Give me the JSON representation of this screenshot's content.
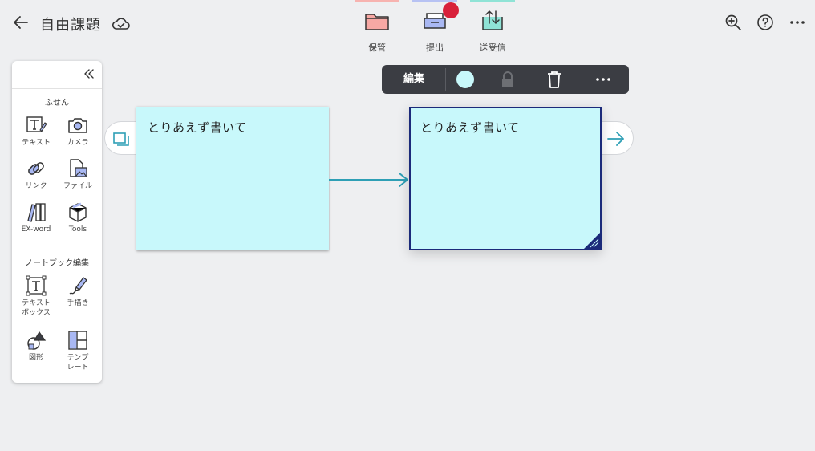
{
  "header": {
    "title": "自由課題",
    "icons": {
      "back": "back-arrow-icon",
      "cloud": "cloud-sync-icon"
    }
  },
  "tool_tabs": [
    {
      "label": "保管",
      "icon": "folder-icon",
      "strip_color": "#f7b3b0"
    },
    {
      "label": "提出",
      "icon": "submit-tray-icon",
      "strip_color": "#b7c2f3"
    },
    {
      "label": "送受信",
      "icon": "send-receive-icon",
      "strip_color": "#8fe3d6"
    }
  ],
  "top_right": {
    "icons": [
      "zoom-in-icon",
      "help-icon",
      "more-icon"
    ]
  },
  "palette": {
    "section1_title": "ふせん",
    "section1_tools": [
      {
        "label": "テキスト",
        "icon": "text-note-icon"
      },
      {
        "label": "カメラ",
        "icon": "camera-icon"
      },
      {
        "label": "リンク",
        "icon": "link-icon"
      },
      {
        "label": "ファイル",
        "icon": "file-icon"
      },
      {
        "label": "EX-word",
        "icon": "exword-icon"
      },
      {
        "label": "Tools",
        "icon": "tools-box-icon"
      }
    ],
    "section2_title": "ノートブック編集",
    "section2_tools": [
      {
        "label": "テキスト\nボックス",
        "icon": "textbox-icon"
      },
      {
        "label": "手描き",
        "icon": "pen-icon"
      },
      {
        "label": "図形",
        "icon": "shape-icon"
      },
      {
        "label": "テンプ\nレート",
        "icon": "template-icon"
      }
    ]
  },
  "edit_bar": {
    "label": "編集",
    "color_swatch": "#c8f8fb",
    "icons": [
      "color-swatch-icon",
      "lock-icon",
      "trash-icon",
      "more-icon"
    ]
  },
  "cards": [
    {
      "text": "とりあえず書いて",
      "color": "#c8f8fb",
      "selected": false
    },
    {
      "text": "とりあえず書いて",
      "color": "#c8f8fb",
      "selected": true
    }
  ],
  "colors": {
    "accent": "#2e9fb5",
    "selection_border": "#1b2a7a",
    "badge": "#d8203a"
  }
}
